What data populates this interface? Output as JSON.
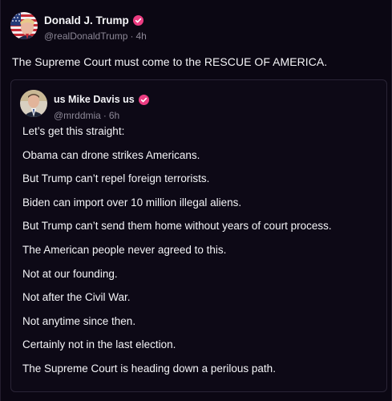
{
  "post": {
    "author": {
      "display_name": "Donald J. Trump",
      "handle": "@realDonaldTrump",
      "time": "4h",
      "avatar_icon": "flag-portrait-avatar",
      "verified_icon": "verified-badge-icon"
    },
    "text": "The Supreme Court must come to the RESCUE OF AMERICA."
  },
  "quote": {
    "author": {
      "display_name": "us Mike Davis us",
      "handle": "@mrddmia",
      "time": "6h",
      "avatar_icon": "portrait-avatar",
      "verified_icon": "verified-badge-icon"
    },
    "lines": [
      "Let’s get this straight:",
      "Obama can drone strikes Americans.",
      "But Trump can’t repel foreign terrorists.",
      "Biden can import over 10 million illegal aliens.",
      "But Trump can’t send them home without years of court process.",
      "The American people never agreed to this.",
      "Not at our founding.",
      "Not after the Civil War.",
      "Not anytime since then.",
      "Certainly not in the last election.",
      "The Supreme Court is heading down a perilous path."
    ]
  },
  "theme": {
    "background": "#0b0713",
    "text": "#f4f4f7",
    "muted": "#8c8796",
    "verified": "#ec3d82"
  }
}
